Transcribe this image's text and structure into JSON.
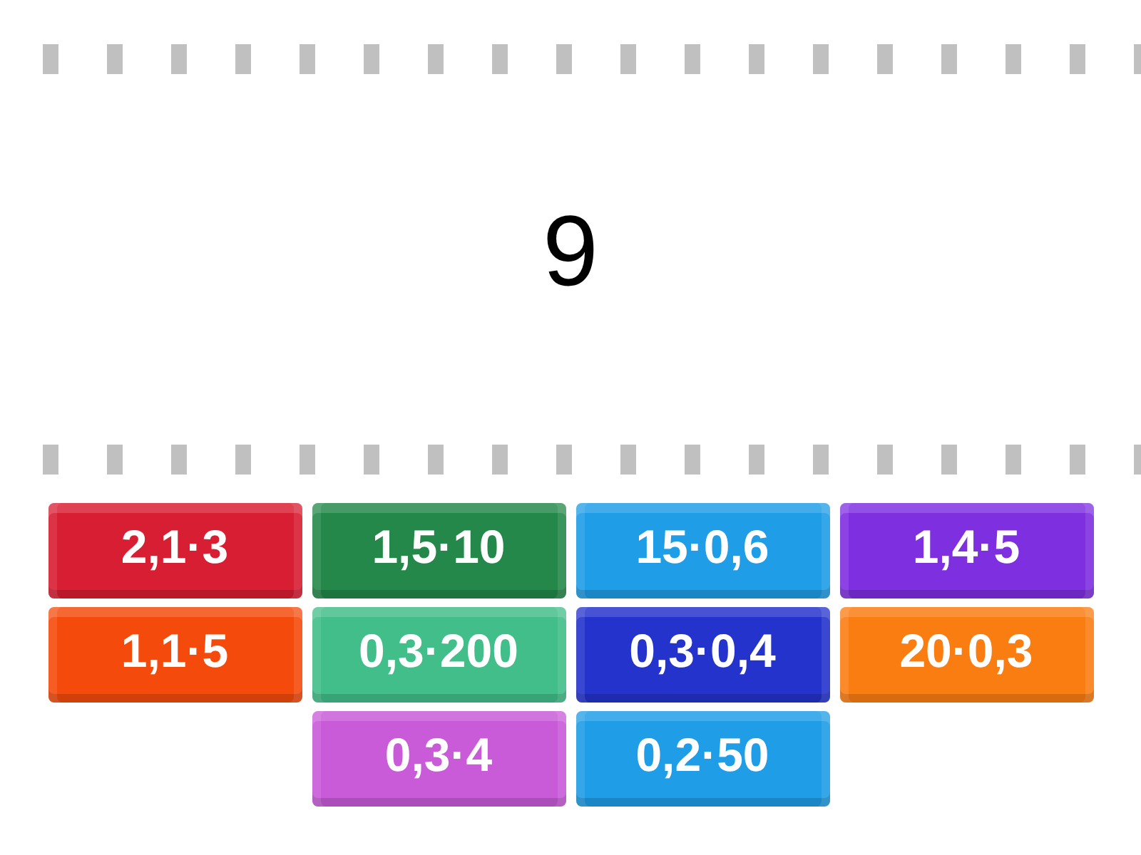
{
  "prompt": {
    "text": "9"
  },
  "tiles": [
    {
      "label": "2,1·3",
      "color": "#d81e33"
    },
    {
      "label": "1,5·10",
      "color": "#24884a"
    },
    {
      "label": "15·0,6",
      "color": "#1f9de6"
    },
    {
      "label": "1,4·5",
      "color": "#7e2fe0"
    },
    {
      "label": "1,1·5",
      "color": "#f44b0c"
    },
    {
      "label": "0,3·200",
      "color": "#42be8a"
    },
    {
      "label": "0,3·0,4",
      "color": "#2433cc"
    },
    {
      "label": "20·0,3",
      "color": "#fa7d12"
    },
    {
      "label": "0,3·4",
      "color": "#c95bd8"
    },
    {
      "label": "0,2·50",
      "color": "#1f9de6"
    }
  ]
}
